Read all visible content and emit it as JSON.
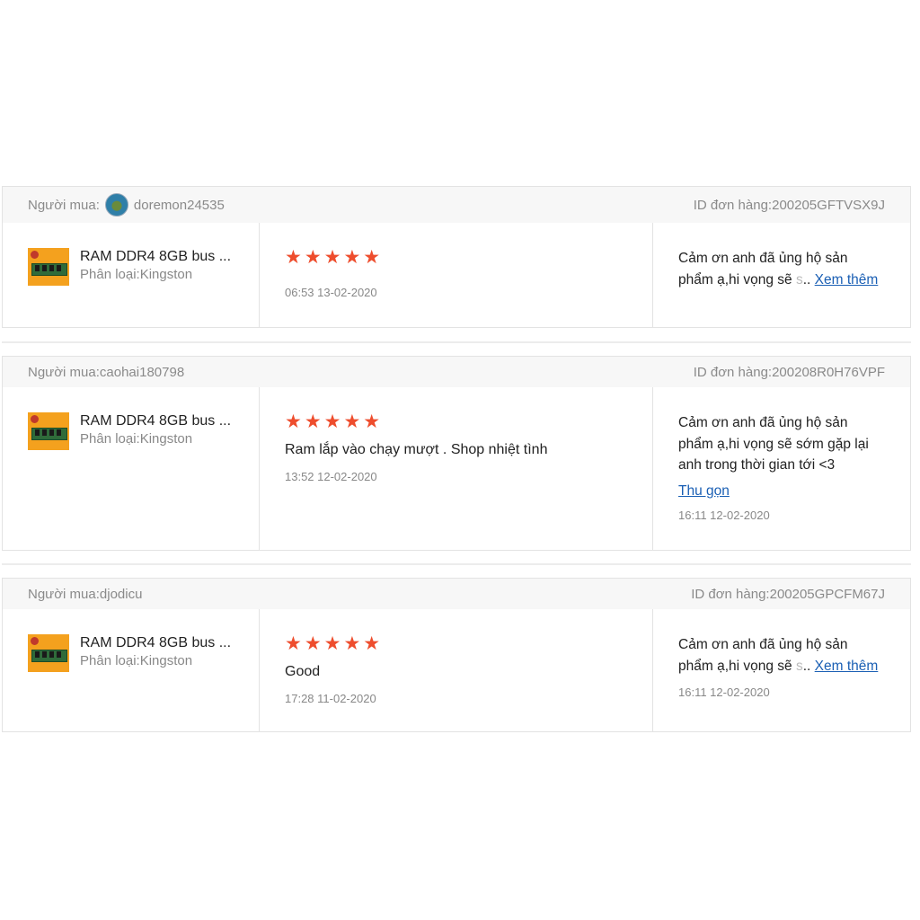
{
  "reviews": [
    {
      "buyer_label": "Người mua:",
      "buyer_name": "doremon24535",
      "order_id": "ID đơn hàng:200205GFTVSX9J",
      "product_name": "RAM DDR4 8GB bus ...",
      "variant": "Phân loại:Kingston",
      "rating": 5,
      "stars": "★★★★★",
      "comment": "",
      "review_time": "06:53 13-02-2020",
      "reply_line1": "Cảm ơn anh đã ủng hộ sản",
      "reply_line2": "phẩm ạ,hi vọng sẽ",
      "reply_fade": " s",
      "reply_ellipsis": "..",
      "reply_more": "Xem thêm",
      "reply_time": ""
    },
    {
      "buyer_label": "Người mua:",
      "buyer_name": "caohai180798",
      "order_id": "ID đơn hàng:200208R0H76VPF",
      "product_name": "RAM DDR4 8GB bus ...",
      "variant": "Phân loại:Kingston",
      "rating": 5,
      "stars": "★★★★★",
      "comment": "Ram lắp vào chạy mượt . Shop nhiệt tình",
      "review_time": "13:52 12-02-2020",
      "reply_full": [
        "Cảm ơn anh đã ủng hộ sản",
        "phẩm ạ,hi vọng sẽ sớm gặp lại",
        "anh trong thời gian tới <3"
      ],
      "reply_less": "Thu gọn",
      "reply_time": "16:11 12-02-2020"
    },
    {
      "buyer_label": "Người mua:",
      "buyer_name": "djodicu",
      "order_id": "ID đơn hàng:200205GPCFM67J",
      "product_name": "RAM DDR4 8GB bus ...",
      "variant": "Phân loại:Kingston",
      "rating": 5,
      "stars": "★★★★★",
      "comment": "Good",
      "review_time": "17:28 11-02-2020",
      "reply_line1": "Cảm ơn anh đã ủng hộ sản",
      "reply_line2": "phẩm ạ,hi vọng sẽ",
      "reply_fade": " s",
      "reply_ellipsis": "..",
      "reply_more": "Xem thêm",
      "reply_time": "16:11 12-02-2020"
    }
  ],
  "colors": {
    "star": "#ee4d2d",
    "link": "#1a5fb4"
  }
}
